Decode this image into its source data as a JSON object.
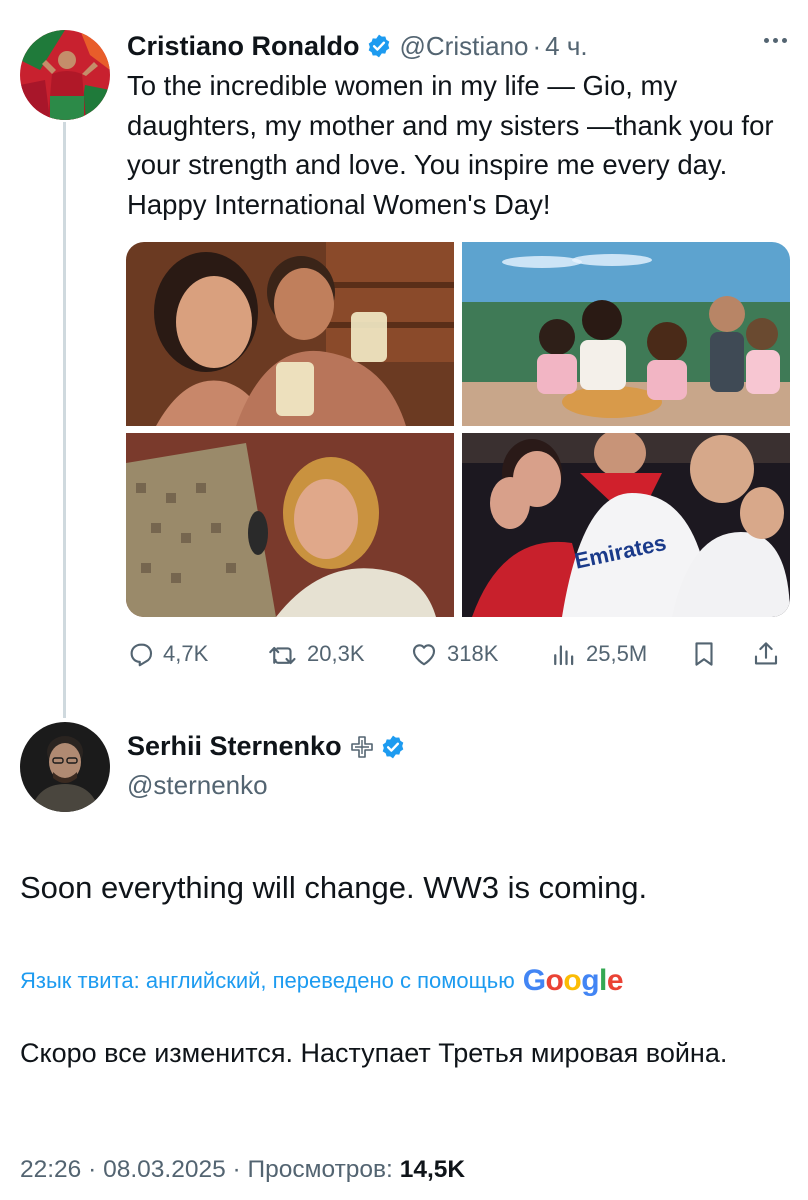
{
  "quoted_tweet": {
    "author_name": "Cristiano Ronaldo",
    "handle": "@Cristiano",
    "separator": "·",
    "time": "4 ч.",
    "text": "To the incredible women in my life — Gio, my daughters, my mother and my sisters —thank you for your strength and love. You inspire me every day. Happy International Women's Day!",
    "stats": {
      "replies": "4,7K",
      "retweets": "20,3K",
      "likes": "318K",
      "views": "25,5M"
    },
    "photos": [
      "photo-couple-selfie",
      "photo-family-birthday",
      "photo-with-mother",
      "photo-with-sisters"
    ]
  },
  "main_tweet": {
    "author_name": "Serhii Sternenko",
    "handle": "@sternenko",
    "text": "Soon everything will change. WW3 is coming.",
    "translation_label": "Язык твита: английский, переведено с помощью",
    "translation_provider": [
      "G",
      "o",
      "o",
      "g",
      "l",
      "e"
    ],
    "translated_text": "Скоро все изменится. Наступает Третья мировая война.",
    "meta": {
      "time": "22:26",
      "date": "08.03.2025",
      "separator": "·",
      "views_label": "Просмотров:",
      "views": "14,5K"
    }
  },
  "colors": {
    "accent": "#1d9bf0",
    "text": "#0f1419",
    "secondary": "#536471",
    "thread_line": "#cfd9de",
    "google": [
      "#4285F4",
      "#EA4335",
      "#FBBC05",
      "#4285F4",
      "#34A853",
      "#EA4335"
    ]
  },
  "icons": [
    "verified-badge-icon",
    "more-icon",
    "reply-icon",
    "retweet-icon",
    "like-icon",
    "views-icon",
    "bookmark-icon",
    "share-icon",
    "plus-cross-icon"
  ]
}
